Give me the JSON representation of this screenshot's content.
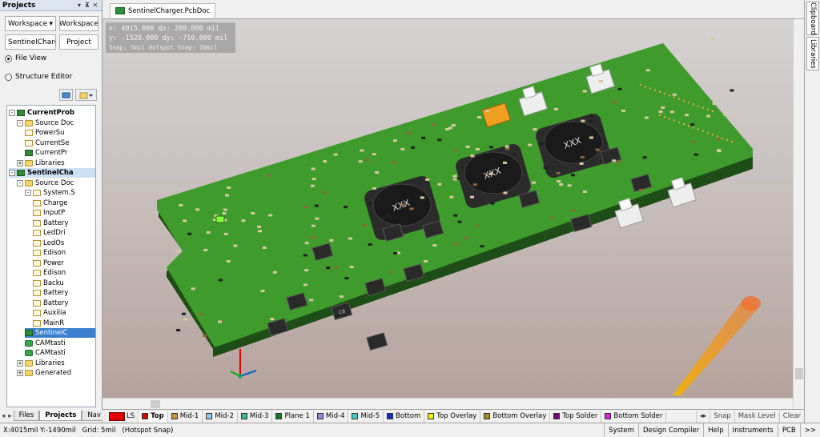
{
  "left_panel": {
    "title": "Projects",
    "workspace_dropdown": "Workspace",
    "workspace_button": "Workspace",
    "project_dropdown": "SentinelCharger",
    "project_button": "Project",
    "radio_file_view": "File View",
    "radio_structure_editor": "Structure Editor",
    "tree": [
      {
        "label": "CurrentProb",
        "level": 0,
        "exp": "-",
        "icon": "pcbproj",
        "bold": true
      },
      {
        "label": "Source Doc",
        "level": 1,
        "exp": "-",
        "icon": "folder"
      },
      {
        "label": "PowerSu",
        "level": 2,
        "icon": "doc"
      },
      {
        "label": "CurrentSe",
        "level": 2,
        "icon": "doc"
      },
      {
        "label": "CurrentPr",
        "level": 2,
        "icon": "pcbproj"
      },
      {
        "label": "Libraries",
        "level": 1,
        "exp": "+",
        "icon": "folder"
      },
      {
        "label": "SentinelCha",
        "level": 0,
        "exp": "-",
        "icon": "pcbproj",
        "bold": true,
        "selected": true
      },
      {
        "label": "Source Doc",
        "level": 1,
        "exp": "-",
        "icon": "folder"
      },
      {
        "label": "System.S",
        "level": 2,
        "exp": "-",
        "icon": "doc"
      },
      {
        "label": "Charge",
        "level": 3,
        "icon": "doc"
      },
      {
        "label": "InputP",
        "level": 3,
        "icon": "doc"
      },
      {
        "label": "Battery",
        "level": 3,
        "icon": "doc"
      },
      {
        "label": "LedDri",
        "level": 3,
        "icon": "doc"
      },
      {
        "label": "LedOs",
        "level": 3,
        "icon": "doc"
      },
      {
        "label": "Edison",
        "level": 3,
        "icon": "doc"
      },
      {
        "label": "Power",
        "level": 3,
        "icon": "doc"
      },
      {
        "label": "Edison",
        "level": 3,
        "icon": "doc"
      },
      {
        "label": "Backu",
        "level": 3,
        "icon": "doc"
      },
      {
        "label": "Battery",
        "level": 3,
        "icon": "doc"
      },
      {
        "label": "Battery",
        "level": 3,
        "icon": "doc"
      },
      {
        "label": "Auxilia",
        "level": 3,
        "icon": "doc"
      },
      {
        "label": "MainR",
        "level": 3,
        "icon": "doc"
      },
      {
        "label": "SentinelC",
        "level": 2,
        "icon": "pcbproj",
        "highlight": true
      },
      {
        "label": "CAMtasti",
        "level": 2,
        "icon": "cam"
      },
      {
        "label": "CAMtasti",
        "level": 2,
        "icon": "cam"
      },
      {
        "label": "Libraries",
        "level": 1,
        "exp": "+",
        "icon": "folder"
      },
      {
        "label": "Generated",
        "level": 1,
        "exp": "+",
        "icon": "folder"
      }
    ],
    "bottom_tabs": [
      "Files",
      "Projects",
      "Nav"
    ]
  },
  "document": {
    "tab_label": "SentinelCharger.PcbDoc"
  },
  "coords": {
    "line1": "x: 4015.000   dx:  200.000 mil",
    "line2": "y: -1520.000   dy: -710.000 mil",
    "line3": "Snap: 5mil Hotspot Snap: 10mil"
  },
  "right_rail": [
    "Clipboard",
    "Libraries"
  ],
  "layers": {
    "ls_label": "LS",
    "tabs": [
      {
        "label": "Top",
        "color": "#e00000",
        "active": true
      },
      {
        "label": "Mid-1",
        "color": "#c89a30"
      },
      {
        "label": "Mid-2",
        "color": "#8fc8f0"
      },
      {
        "label": "Mid-3",
        "color": "#30c090"
      },
      {
        "label": "Plane 1",
        "color": "#108020"
      },
      {
        "label": "Mid-4",
        "color": "#a080e0"
      },
      {
        "label": "Mid-5",
        "color": "#40d0d0"
      },
      {
        "label": "Bottom",
        "color": "#1030e0"
      },
      {
        "label": "Top Overlay",
        "color": "#f0f000"
      },
      {
        "label": "Bottom Overlay",
        "color": "#a09020"
      },
      {
        "label": "Top Solder",
        "color": "#800080"
      },
      {
        "label": "Bottom Solder",
        "color": "#e020e0"
      }
    ],
    "snap": "Snap",
    "mask_level": "Mask Level",
    "clear": "Clear"
  },
  "status": {
    "coords": "X:4015mil Y:-1490mil",
    "grid": "Grid: 5mil",
    "hotspot": "(Hotspot Snap)",
    "buttons": [
      "System",
      "Design Compiler",
      "Help",
      "Instruments",
      "PCB",
      ">>"
    ]
  },
  "pcb": {
    "inductor_label": "XXX",
    "ic_label": "C8",
    "colors": {
      "board": "#3e9b2c",
      "board_edge": "#1f4d17",
      "connector": "#eeeeee",
      "tantalum": "#f0a020"
    }
  }
}
